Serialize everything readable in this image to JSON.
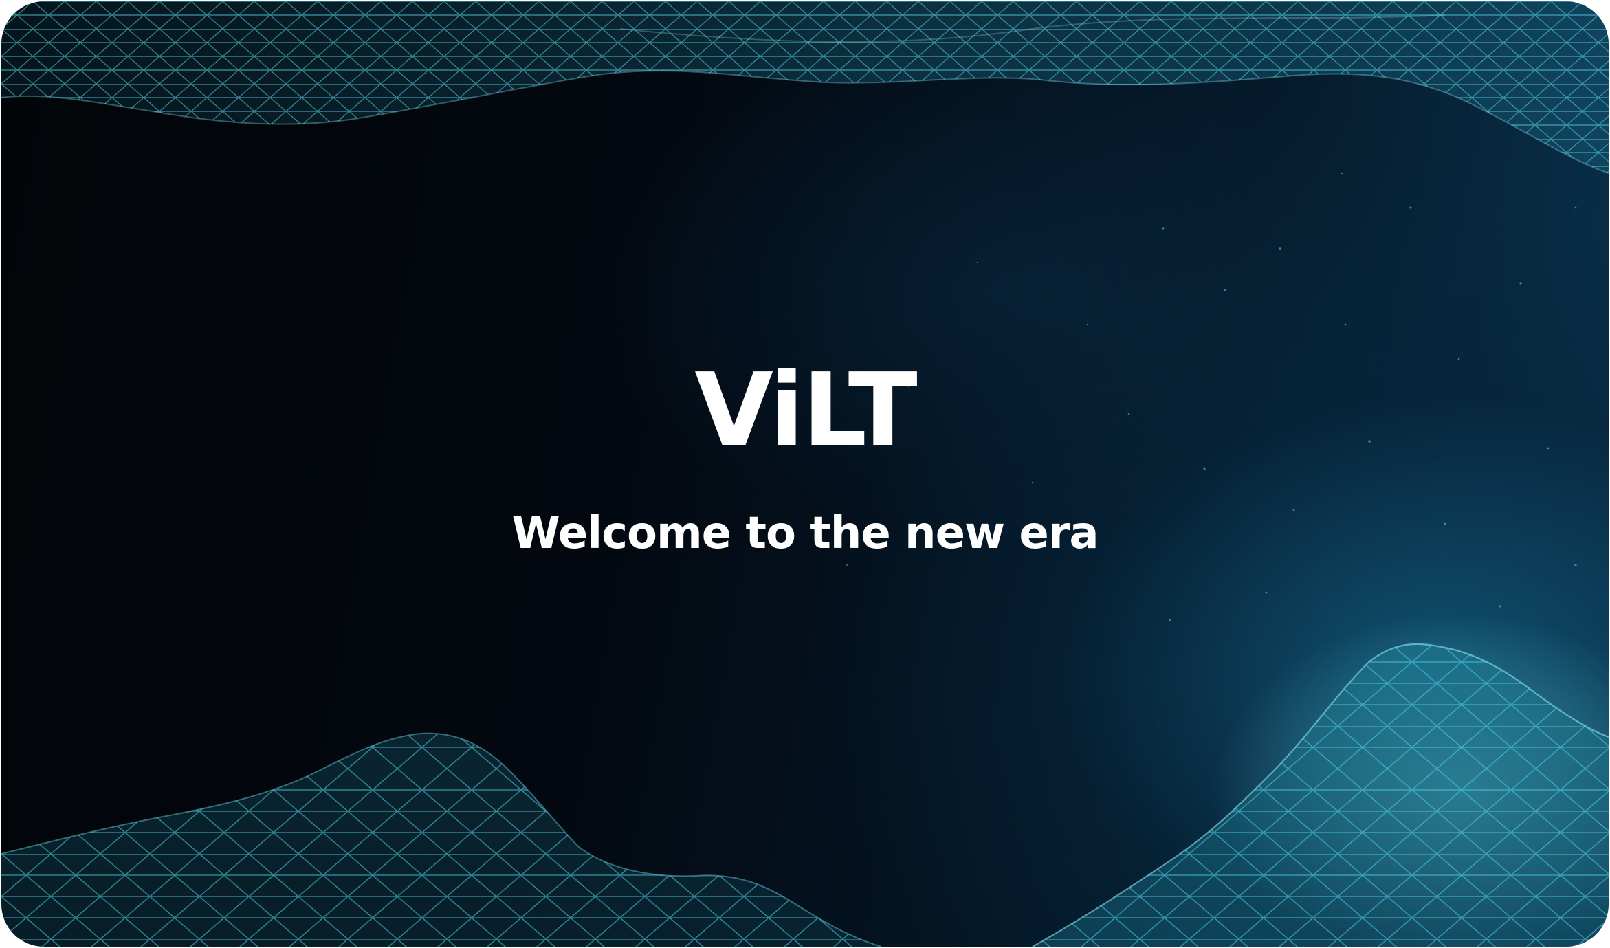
{
  "splash": {
    "app_name": "ViLT",
    "tagline": "Welcome to the new era"
  },
  "colors": {
    "background_dark": "#030810",
    "mesh_cyan": "#4fd2e6",
    "text": "#ffffff"
  }
}
